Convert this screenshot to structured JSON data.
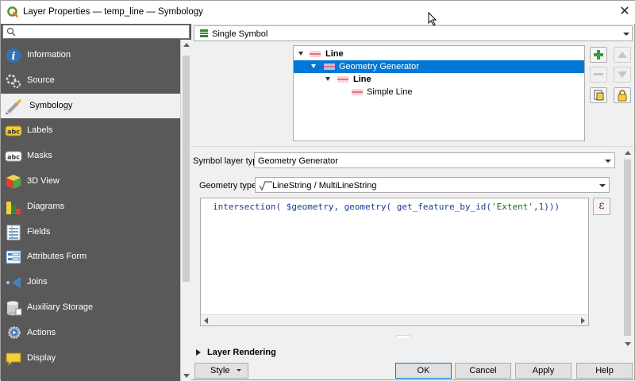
{
  "window": {
    "title": "Layer Properties — temp_line — Symbology",
    "close_glyph": "✕"
  },
  "sidebar": {
    "search_placeholder": "",
    "items": [
      {
        "label": "Information",
        "icon": "information-icon"
      },
      {
        "label": "Source",
        "icon": "source-icon"
      },
      {
        "label": "Symbology",
        "icon": "symbology-icon",
        "selected": true
      },
      {
        "label": "Labels",
        "icon": "labels-icon"
      },
      {
        "label": "Masks",
        "icon": "masks-icon"
      },
      {
        "label": "3D View",
        "icon": "3d-view-icon"
      },
      {
        "label": "Diagrams",
        "icon": "diagrams-icon"
      },
      {
        "label": "Fields",
        "icon": "fields-icon"
      },
      {
        "label": "Attributes Form",
        "icon": "attributes-form-icon"
      },
      {
        "label": "Joins",
        "icon": "joins-icon"
      },
      {
        "label": "Auxiliary Storage",
        "icon": "auxiliary-storage-icon"
      },
      {
        "label": "Actions",
        "icon": "actions-icon"
      },
      {
        "label": "Display",
        "icon": "display-icon"
      }
    ]
  },
  "renderer": {
    "selected": "Single Symbol"
  },
  "symbol_tree": {
    "rows": [
      {
        "label": "Line",
        "bold": true
      },
      {
        "label": "Geometry Generator",
        "bold": false,
        "selected": true
      },
      {
        "label": "Line",
        "bold": true
      },
      {
        "label": "Simple Line",
        "bold": false
      }
    ]
  },
  "symbol_layer": {
    "type_label": "Symbol layer type",
    "type_value": "Geometry Generator",
    "geometry_type_label": "Geometry type",
    "geometry_type_value": "LineString / MultiLineString",
    "expression_parts": {
      "before": "intersection( $geometry, geometry( get_feature_by_id(",
      "string": "'Extent'",
      "after": ",1)))"
    },
    "expression_button": "ε"
  },
  "layer_rendering": {
    "label": "Layer Rendering"
  },
  "buttons": {
    "style": "Style",
    "ok": "OK",
    "cancel": "Cancel",
    "apply": "Apply",
    "help": "Help"
  },
  "colors": {
    "sidebar_bg": "#595959",
    "selection": "#0078d7",
    "line_symbol": "#e8727a"
  }
}
